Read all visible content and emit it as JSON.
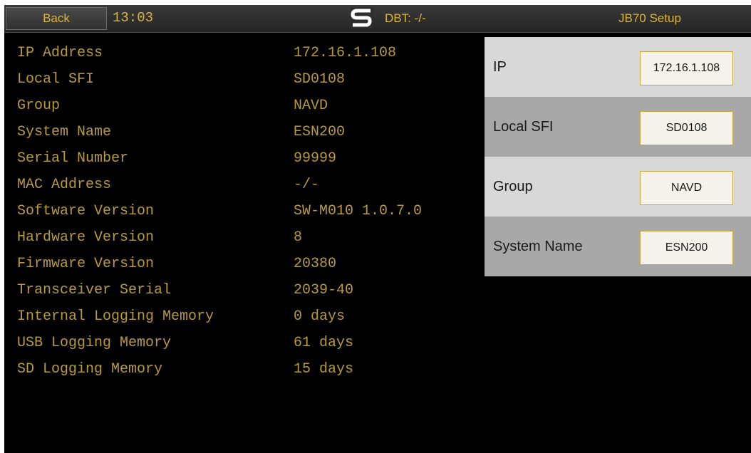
{
  "header": {
    "back_label": "Back",
    "time": "13:03",
    "logo_icon": "s-logo-icon",
    "dbt": "DBT: -/-",
    "title": "JB70 Setup"
  },
  "info": [
    {
      "label": "IP Address",
      "value": "172.16.1.108"
    },
    {
      "label": "Local SFI",
      "value": "SD0108"
    },
    {
      "label": "Group",
      "value": "NAVD"
    },
    {
      "label": "System Name",
      "value": "ESN200"
    },
    {
      "label": "Serial Number",
      "value": "99999"
    },
    {
      "label": "MAC Address",
      "value": "-/-"
    },
    {
      "label": "Software Version",
      "value": "SW-M010 1.0.7.0"
    },
    {
      "label": "Hardware Version",
      "value": "8"
    },
    {
      "label": "Firmware Version",
      "value": "20380"
    },
    {
      "label": "Transceiver Serial",
      "value": "2039-40"
    },
    {
      "label": "Internal Logging Memory",
      "value": "0 days"
    },
    {
      "label": "USB Logging Memory",
      "value": "61 days"
    },
    {
      "label": "SD Logging Memory",
      "value": "15 days"
    }
  ],
  "settings": [
    {
      "label": "IP",
      "value": "172.16.1.108"
    },
    {
      "label": "Local SFI",
      "value": "SD0108"
    },
    {
      "label": "Group",
      "value": "NAVD"
    },
    {
      "label": "System Name",
      "value": "ESN200"
    }
  ],
  "colors": {
    "accent": "#d9b441",
    "text_dim": "#b79a3e",
    "panel_light": "#d8d8d8",
    "panel_dark": "#a8a8a8",
    "background": "#000000"
  }
}
